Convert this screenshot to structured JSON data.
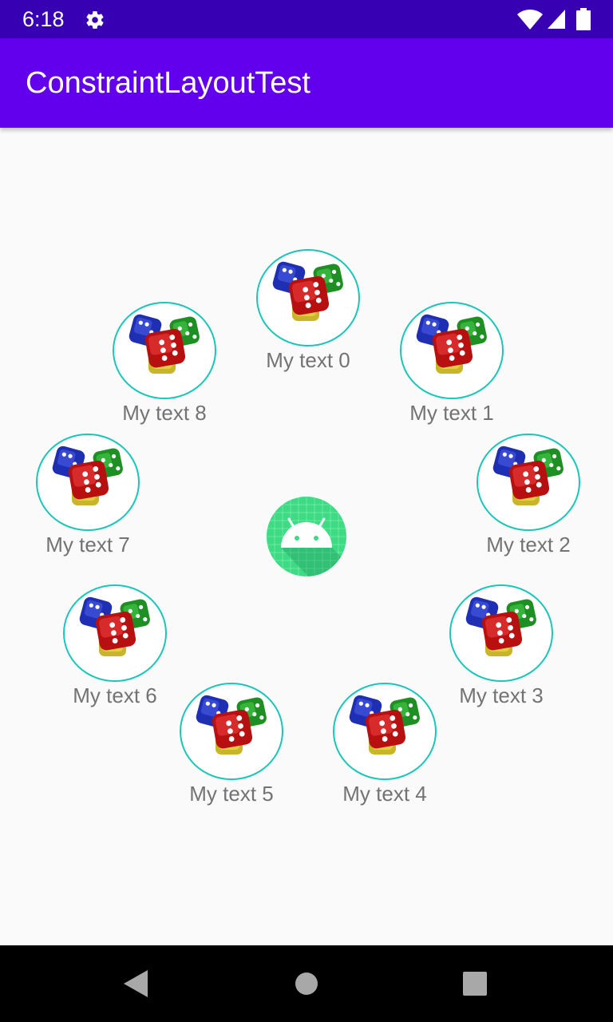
{
  "status_bar": {
    "time": "6:18",
    "icons": [
      "gear-icon",
      "wifi-icon",
      "signal-icon",
      "battery-icon"
    ]
  },
  "app_bar": {
    "title": "ConstraintLayoutTest"
  },
  "items": [
    {
      "label": "My text 0"
    },
    {
      "label": "My text 1"
    },
    {
      "label": "My text 2"
    },
    {
      "label": "My text 3"
    },
    {
      "label": "My text 4"
    },
    {
      "label": "My text 5"
    },
    {
      "label": "My text 6"
    },
    {
      "label": "My text 7"
    },
    {
      "label": "My text 8"
    }
  ],
  "center": {
    "icon": "android-logo-icon"
  },
  "nav_bar": {
    "buttons": [
      "back-icon",
      "home-icon",
      "recents-icon"
    ]
  },
  "colors": {
    "status_bar": "#3700b3",
    "app_bar": "#6200ee",
    "circle_border": "#1ac6b8",
    "label_text": "#737373",
    "android_green": "#3ddc84"
  }
}
